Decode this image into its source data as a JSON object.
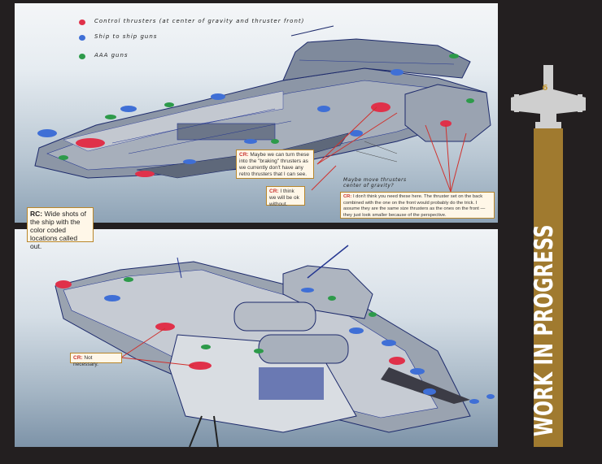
{
  "legend": {
    "red": "Control thrusters (at center of gravity and thruster front)",
    "blue": "Ship to ship guns",
    "green": "AAA guns"
  },
  "colors": {
    "red": "#e0314a",
    "blue": "#3f6fd6",
    "green": "#2d9a4a",
    "accent": "#a07a2f"
  },
  "notes": {
    "cr1": {
      "tag": "CR:",
      "text": "Maybe we can turn these into the \"braking\" thrusters as we currently don't have any retro thrusters that I can see."
    },
    "cr2": {
      "tag": "CR:",
      "text": "I think we will be ok without."
    },
    "cr3": {
      "tag": "CR:",
      "text": "I don't think you need these here. The thruster set on the back combined with the one on the front would probably do the trick. I assume they are the same size thrusters as the ones on the front — they just look smaller because of the perspective."
    },
    "cr4": {
      "tag": "CR:",
      "text": "Not necessary."
    },
    "rc": {
      "tag": "RC:",
      "text": "Wide shots of the ship with the color coded locations called out."
    }
  },
  "handwritten": "Maybe move thrusters center of gravity?",
  "badge": {
    "number": "6",
    "label": "WORK IN PROGRESS"
  }
}
